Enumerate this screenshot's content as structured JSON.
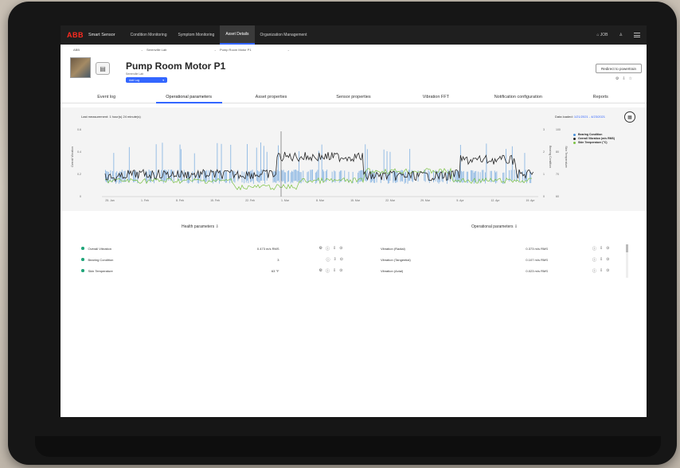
{
  "nav": {
    "logo": "ABB",
    "app_name": "Smart Sensor",
    "tabs": [
      {
        "label": "Condition Monitoring",
        "active": false
      },
      {
        "label": "Symptom Monitoring",
        "active": false
      },
      {
        "label": "Asset Details",
        "active": true
      },
      {
        "label": "Organization Management",
        "active": false
      }
    ],
    "user": "JOB"
  },
  "breadcrumb": [
    "ABB",
    "Serenville Lab",
    "Pump Room Motor P1"
  ],
  "asset": {
    "title": "Pump Room Motor P1",
    "subtitle": "Serenville Lab",
    "add_log": "Add Log",
    "redirect": "Redirect to powertrain"
  },
  "tabs": [
    {
      "label": "Event log",
      "active": false
    },
    {
      "label": "Operational parameters",
      "active": true
    },
    {
      "label": "Asset properties",
      "active": false
    },
    {
      "label": "Sensor properties",
      "active": false
    },
    {
      "label": "Vibration FFT",
      "active": false
    },
    {
      "label": "Notification configuration",
      "active": false
    },
    {
      "label": "Reports",
      "active": false
    }
  ],
  "chart": {
    "last_measurement": "Last measurement: 1 hour(s) 24 minute(s)",
    "data_loaded_label": "Data loaded:",
    "data_loaded_range": "1/21/2021 - 4/23/2021"
  },
  "chart_data": {
    "type": "line",
    "x_ticks": [
      "25. Jan",
      "1. Feb",
      "8. Feb",
      "15. Feb",
      "22. Feb",
      "1. Mar",
      "8. Mar",
      "15. Mar",
      "22. Mar",
      "29. Mar",
      "5. Apr",
      "12. Apr",
      "19. Apr"
    ],
    "y_left_label": "Overall Vibration",
    "y_left_ticks": [
      "0",
      "0.2",
      "0.4",
      "0.6"
    ],
    "y_right1_label": "Bearing Condition",
    "y_right1_ticks": [
      "0",
      "1",
      "2",
      "3"
    ],
    "y_right2_label": "Skin Temperature",
    "y_right2_ticks": [
      "60",
      "70",
      "80",
      "100"
    ],
    "series": [
      {
        "name": "Bearing Condition",
        "color": "#4a90d9"
      },
      {
        "name": "Overall Vibration (m/s RMS)",
        "color": "#262626"
      },
      {
        "name": "Skin Temperature (°C)",
        "color": "#7cc243"
      }
    ]
  },
  "health": {
    "title": "Health parameters",
    "rows": [
      {
        "name": "Overall Vibration",
        "value": "0.473 m/s RMS"
      },
      {
        "name": "Bearing Condition",
        "value": "3"
      },
      {
        "name": "Skin Temperature",
        "value": "63 °F"
      }
    ]
  },
  "operational": {
    "title": "Operational parameters",
    "rows": [
      {
        "name": "Vibration (Radial)",
        "value": "0.373 m/s RMS"
      },
      {
        "name": "Vibration (Tangential)",
        "value": "0.107 m/s RMS"
      },
      {
        "name": "Vibration (Axial)",
        "value": "0.023 m/s RMS"
      }
    ]
  }
}
